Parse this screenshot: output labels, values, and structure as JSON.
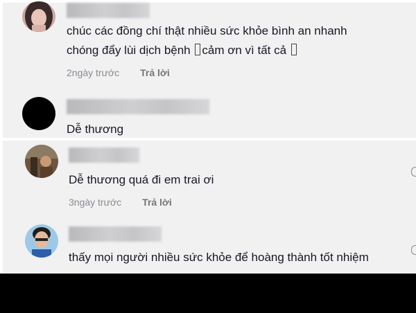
{
  "comments": [
    {
      "text_line1": "chúc các đồng chí thật nhiều sức khỏe bình an nhanh",
      "text_line2a": "chóng đẩy lùi dịch bệnh ",
      "text_line2b": "cảm ơn vì tất cả ",
      "time": "2ngày trước",
      "reply": "Trả lời"
    },
    {
      "text_line1": "Dễ thương"
    },
    {
      "text_line1": "Dễ thương quá đi em trai ơi",
      "time": "3ngày trước",
      "reply": "Trả lời"
    },
    {
      "text_line1": "thấy mọi người nhiều sức khỏe để hoàng thành tốt nhiệm"
    }
  ],
  "icons": {
    "more": "more-options-icon"
  },
  "colors": {
    "background": "#f1f1f2",
    "text": "#161823",
    "meta": "#8a8b91",
    "bottom_bar": "#000000"
  }
}
